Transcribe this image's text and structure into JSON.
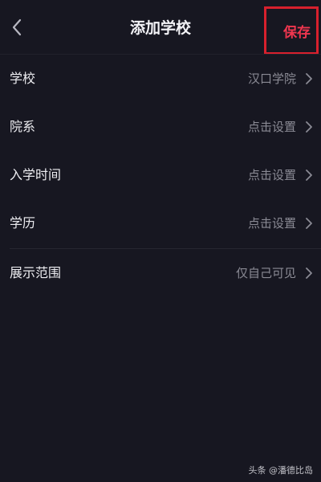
{
  "header": {
    "back_icon": "chevron-left-icon",
    "title": "添加学校",
    "save_label": "保存"
  },
  "rows": [
    {
      "label": "学校",
      "value": "汉口学院"
    },
    {
      "label": "院系",
      "value": "点击设置"
    },
    {
      "label": "入学时间",
      "value": "点击设置"
    },
    {
      "label": "学历",
      "value": "点击设置"
    },
    {
      "label": "展示范围",
      "value": "仅自己可见"
    }
  ],
  "watermark": "头条 @潘德比岛",
  "colors": {
    "background": "#171721",
    "save_text": "#f0364f",
    "highlight_box": "#d8202d",
    "value_text": "#8a8a94"
  }
}
